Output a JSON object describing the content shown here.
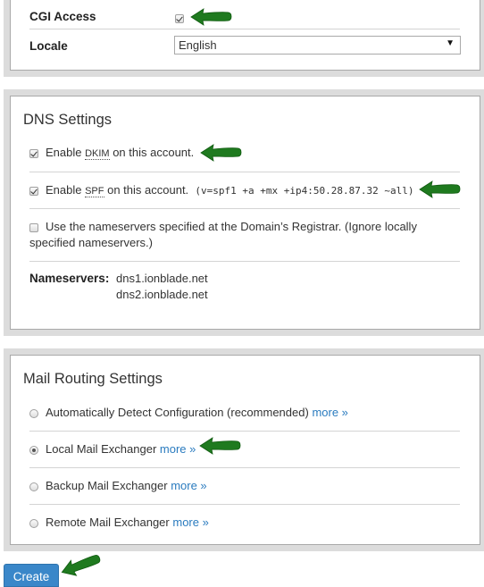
{
  "account_settings": {
    "cgi_access": {
      "label": "CGI Access",
      "checked": true
    },
    "locale": {
      "label": "Locale",
      "selected": "English"
    }
  },
  "dns_settings": {
    "title": "DNS Settings",
    "dkim": {
      "prefix": "Enable ",
      "abbr": "DKIM",
      "suffix": " on this account.",
      "checked": true
    },
    "spf": {
      "prefix": "Enable ",
      "abbr": "SPF",
      "suffix": " on this account.",
      "record": "(v=spf1 +a +mx +ip4:50.28.87.32 ~all)",
      "checked": true
    },
    "registrar_ns": {
      "label": "Use the nameservers specified at the Domain’s Registrar. (Ignore locally specified nameservers.)",
      "checked": false
    },
    "nameservers": {
      "label": "Nameservers:",
      "values": [
        "dns1.ionblade.net",
        "dns2.ionblade.net"
      ]
    }
  },
  "mail_routing": {
    "title": "Mail Routing Settings",
    "more_label": "more »",
    "options": [
      {
        "label": "Automatically Detect Configuration (recommended)",
        "selected": false
      },
      {
        "label": "Local Mail Exchanger",
        "selected": true
      },
      {
        "label": "Backup Mail Exchanger",
        "selected": false
      },
      {
        "label": "Remote Mail Exchanger",
        "selected": false
      }
    ]
  },
  "actions": {
    "create_label": "Create"
  },
  "colors": {
    "link": "#2a7bbf",
    "button": "#3a87c9",
    "annotation_arrow": "#1f7a1f"
  }
}
